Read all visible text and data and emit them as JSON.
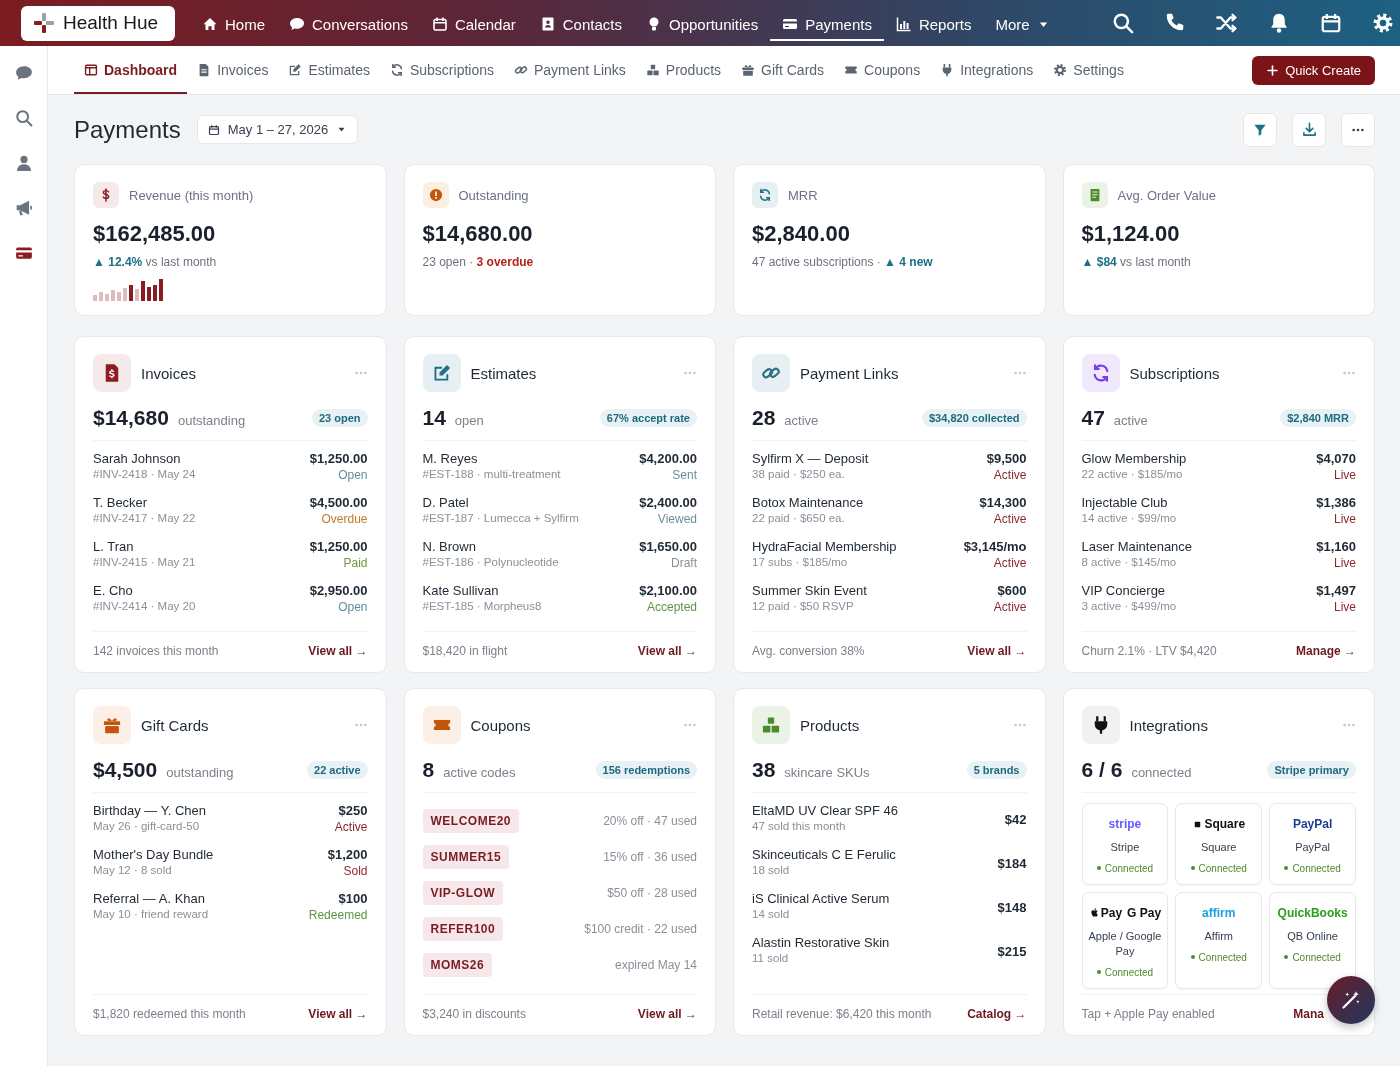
{
  "top_nav": {
    "brand": "Health Hue",
    "items": [
      {
        "kind": "home",
        "label": "Home",
        "selected": false
      },
      {
        "kind": "chat",
        "label": "Conversations",
        "selected": false
      },
      {
        "kind": "calendar",
        "label": "Calendar",
        "selected": false
      },
      {
        "kind": "contact",
        "label": "Contacts",
        "selected": false
      },
      {
        "kind": "bulb",
        "label": "Opportunities",
        "selected": false
      },
      {
        "kind": "card",
        "label": "Payments",
        "selected": true
      },
      {
        "kind": "chart",
        "label": "Reports",
        "selected": false
      },
      {
        "kind": "menu",
        "label": "More",
        "selected": false
      }
    ]
  },
  "sidebar": {
    "items": [
      {
        "kind": "chat",
        "selected": false
      },
      {
        "kind": "search",
        "selected": false
      },
      {
        "kind": "person",
        "selected": false
      },
      {
        "kind": "megaphone",
        "selected": false
      },
      {
        "kind": "card",
        "selected": true
      }
    ]
  },
  "sub_nav": {
    "tabs": [
      {
        "kind": "dashboard",
        "label": "Dashboard",
        "selected": true
      },
      {
        "kind": "doc",
        "label": "Invoices",
        "selected": false
      },
      {
        "kind": "pencil",
        "label": "Estimates",
        "selected": false
      },
      {
        "kind": "refresh",
        "label": "Subscriptions",
        "selected": false
      },
      {
        "kind": "link",
        "label": "Payment Links",
        "selected": false
      },
      {
        "kind": "boxes",
        "label": "Products",
        "selected": false
      },
      {
        "kind": "gift",
        "label": "Gift Cards",
        "selected": false
      },
      {
        "kind": "ticket",
        "label": "Coupons",
        "selected": false
      },
      {
        "kind": "plug",
        "label": "Integrations",
        "selected": false
      },
      {
        "kind": "gear",
        "label": "Settings",
        "selected": false
      }
    ],
    "action": "Quick Create"
  },
  "header": {
    "title": "Payments",
    "date_range": "May 1 – 27, 2026"
  },
  "kpis": [
    {
      "kind": "dollar",
      "label": "Revenue (this month)",
      "value": "$162,485.00",
      "note": [
        {
          "text": "▲ 12.4%",
          "kind": "up"
        },
        {
          "text": "vs last month",
          "kind": "muted"
        }
      ],
      "sparkline": true
    },
    {
      "kind": "alert",
      "label": "Outstanding",
      "value": "$14,680.00",
      "note": [
        {
          "text": "23 open ·",
          "kind": "muted"
        },
        {
          "text": "3 overdue",
          "kind": "alert"
        }
      ]
    },
    {
      "kind": "refresh",
      "label": "MRR",
      "value": "$2,840.00",
      "note": [
        {
          "text": "47 active subscriptions ·",
          "kind": "muted"
        },
        {
          "text": "▲ 4 new",
          "kind": "up"
        }
      ]
    },
    {
      "kind": "receipt",
      "label": "Avg. Order Value",
      "value": "$1,124.00",
      "note": [
        {
          "text": "▲ $84",
          "kind": "up"
        },
        {
          "text": "vs last month",
          "kind": "muted"
        }
      ]
    }
  ],
  "cards": [
    {
      "kind": "list",
      "title": "Invoices",
      "value": "$14,680",
      "unit": "outstanding",
      "badge": "23 open",
      "rows": [
        {
          "name": "Sarah Johnson",
          "detail": "#INV-2418 · May 24",
          "amount": "$1,250.00",
          "status": "Open",
          "color": "#5f8f9a"
        },
        {
          "name": "T. Becker",
          "detail": "#INV-2417 · May 22",
          "amount": "$4,500.00",
          "status": "Overdue",
          "color": "#c07a2c"
        },
        {
          "name": "L. Tran",
          "detail": "#INV-2415 · May 21",
          "amount": "$1,250.00",
          "status": "Paid",
          "color": "#6f9a3e"
        },
        {
          "name": "E. Cho",
          "detail": "#INV-2414 · May 20",
          "amount": "$2,950.00",
          "status": "Open",
          "color": "#5f8f9a"
        }
      ],
      "footer": "142 invoices this month",
      "link": "View all →"
    },
    {
      "kind": "list",
      "title": "Estimates",
      "value": "14",
      "unit": "open",
      "badge": "67% accept rate",
      "rows": [
        {
          "name": "M. Reyes",
          "detail": "#EST-188 · multi-treatment",
          "amount": "$4,200.00",
          "status": "Sent",
          "color": "#6b8f99"
        },
        {
          "name": "D. Patel",
          "detail": "#EST-187 · Lumecca + Sylfirm",
          "amount": "$2,400.00",
          "status": "Viewed",
          "color": "#6b8f99"
        },
        {
          "name": "N. Brown",
          "detail": "#EST-186 · Polynucleotide",
          "amount": "$1,650.00",
          "status": "Draft",
          "color": "#8a8f96"
        },
        {
          "name": "Kate Sullivan",
          "detail": "#EST-185 · Morpheus8",
          "amount": "$2,100.00",
          "status": "Accepted",
          "color": "#5d9444"
        }
      ],
      "footer": "$18,420 in flight",
      "link": "View all →"
    },
    {
      "kind": "list",
      "title": "Payment Links",
      "value": "28",
      "unit": "active",
      "badge": "$34,820 collected",
      "rows": [
        {
          "name": "Sylfirm X — Deposit",
          "detail": "38 paid · $250 ea.",
          "amount": "$9,500",
          "status": "Active",
          "color": "#8a2a2f"
        },
        {
          "name": "Botox Maintenance",
          "detail": "22 paid · $650 ea.",
          "amount": "$14,300",
          "status": "Active",
          "color": "#8a2a2f"
        },
        {
          "name": "HydraFacial Membership",
          "detail": "17 subs · $185/mo",
          "amount": "$3,145/mo",
          "status": "Active",
          "color": "#8a2a2f"
        },
        {
          "name": "Summer Skin Event",
          "detail": "12 paid · $50 RSVP",
          "amount": "$600",
          "status": "Active",
          "color": "#8a2a2f"
        }
      ],
      "footer": "Avg. conversion 38%",
      "link": "View all →"
    },
    {
      "kind": "list",
      "title": "Subscriptions",
      "value": "47",
      "unit": "active",
      "badge": "$2,840 MRR",
      "rows": [
        {
          "name": "Glow Membership",
          "detail": "22 active · $185/mo",
          "amount": "$4,070",
          "status": "Live",
          "color": "#8a2a2f"
        },
        {
          "name": "Injectable Club",
          "detail": "14 active · $99/mo",
          "amount": "$1,386",
          "status": "Live",
          "color": "#8a2a2f"
        },
        {
          "name": "Laser Maintenance",
          "detail": "8 active · $145/mo",
          "amount": "$1,160",
          "status": "Live",
          "color": "#8a2a2f"
        },
        {
          "name": "VIP Concierge",
          "detail": "3 active · $499/mo",
          "amount": "$1,497",
          "status": "Live",
          "color": "#8a2a2f"
        }
      ],
      "footer": "Churn 2.1% · LTV $4,420",
      "link": "Manage →"
    },
    {
      "kind": "list",
      "title": "Gift Cards",
      "value": "$4,500",
      "unit": "outstanding",
      "badge": "22 active",
      "rows": [
        {
          "name": "Birthday — Y. Chen",
          "detail": "May 26 · gift-card-50",
          "amount": "$250",
          "status": "Active",
          "color": "#8a2a2f"
        },
        {
          "name": "Mother's Day Bundle",
          "detail": "May 12 · 8 sold",
          "amount": "$1,200",
          "status": "Sold",
          "color": "#8a2a2f"
        },
        {
          "name": "Referral — A. Khan",
          "detail": "May 10 · friend reward",
          "amount": "$100",
          "status": "Redeemed",
          "color": "#5d9444"
        }
      ],
      "footer": "$1,820 redeemed this month",
      "link": "View all →"
    },
    {
      "kind": "codes",
      "title": "Coupons",
      "value": "8",
      "unit": "active codes",
      "badge": "156 redemptions",
      "rows": [
        {
          "code": "WELCOME20",
          "detail": "20% off · 47 used"
        },
        {
          "code": "SUMMER15",
          "detail": "15% off · 36 used"
        },
        {
          "code": "VIP-GLOW",
          "detail": "$50 off · 28 used"
        },
        {
          "code": "REFER100",
          "detail": "$100 credit · 22 used"
        },
        {
          "code": "MOMS26",
          "detail": "expired May 14"
        }
      ],
      "footer": "$3,240 in discounts",
      "link": "View all →"
    },
    {
      "kind": "list",
      "title": "Products",
      "value": "38",
      "unit": "skincare SKUs",
      "badge": "5 brands",
      "rows": [
        {
          "name": "EltaMD UV Clear SPF 46",
          "detail": "47 sold this month",
          "amount": "$42"
        },
        {
          "name": "Skinceuticals C E Ferulic",
          "detail": "18 sold",
          "amount": "$184"
        },
        {
          "name": "iS Clinical Active Serum",
          "detail": "14 sold",
          "amount": "$148"
        },
        {
          "name": "Alastin Restorative Skin",
          "detail": "11 sold",
          "amount": "$215"
        }
      ],
      "footer": "Retail revenue: $6,420 this month",
      "link": "Catalog →"
    },
    {
      "kind": "tiles",
      "title": "Integrations",
      "value": "6 / 6",
      "unit": "connected",
      "badge": "Stripe primary",
      "tiles": [
        {
          "logo": [
            {
              "kind": "text",
              "text": "stripe"
            }
          ],
          "color": "#635bff",
          "name": "Stripe",
          "status": "Connected"
        },
        {
          "logo": [
            {
              "kind": "square",
              "text": "Square"
            }
          ],
          "color": "#111111",
          "name": "Square",
          "status": "Connected"
        },
        {
          "logo": [
            {
              "kind": "text",
              "text": "PayPal"
            }
          ],
          "color": "#1b3d8f",
          "name": "PayPal",
          "status": "Connected"
        },
        {
          "logo": [
            {
              "kind": "apple",
              "text": "Pay"
            },
            {
              "kind": "text",
              "text": "G Pay"
            }
          ],
          "color": "#111111",
          "name": "Apple / Google Pay",
          "status": "Connected"
        },
        {
          "logo": [
            {
              "kind": "text",
              "text": "affirm"
            }
          ],
          "color": "#1aa0e0",
          "name": "Affirm",
          "status": "Connected"
        },
        {
          "logo": [
            {
              "kind": "text",
              "text": "QuickBooks"
            }
          ],
          "color": "#2ca01c",
          "name": "QB Online",
          "status": "Connected"
        }
      ],
      "footer": "Tap + Apple Pay enabled",
      "link": "Mana"
    }
  ]
}
